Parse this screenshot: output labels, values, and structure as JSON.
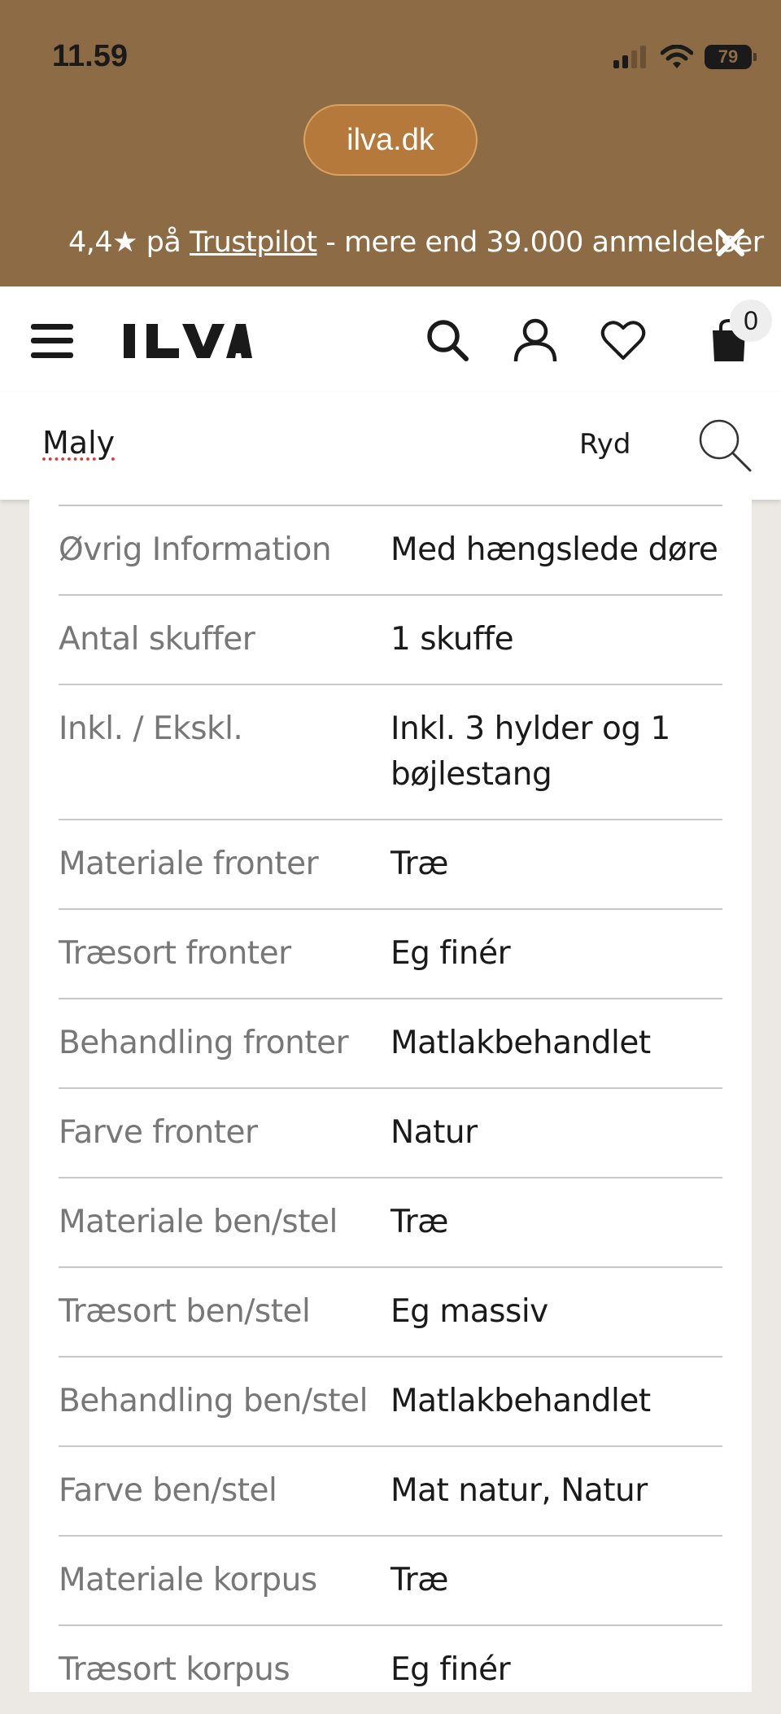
{
  "status_bar": {
    "time": "11.59",
    "battery": "79"
  },
  "browser": {
    "url": "ilva.dk"
  },
  "banner": {
    "rating": "4,4★ på",
    "link": "Trustpilot",
    "suffix": "- mere end 39.000 anmeldelser"
  },
  "header": {
    "logo": "ILVA",
    "cart_count": "0"
  },
  "search": {
    "value": "Maly",
    "clear_label": "Ryd"
  },
  "specs": [
    {
      "label": "Øvrig Information",
      "value": "Med hængslede døre"
    },
    {
      "label": "Antal skuffer",
      "value": "1 skuffe"
    },
    {
      "label": "Inkl. / Ekskl.",
      "value": "Inkl. 3 hylder og 1 bøjlestang"
    },
    {
      "label": "Materiale fronter",
      "value": "Træ"
    },
    {
      "label": "Træsort fronter",
      "value": "Eg finér"
    },
    {
      "label": "Behandling fronter",
      "value": "Matlakbehandlet"
    },
    {
      "label": "Farve fronter",
      "value": "Natur"
    },
    {
      "label": "Materiale ben/stel",
      "value": "Træ"
    },
    {
      "label": "Træsort ben/stel",
      "value": "Eg massiv"
    },
    {
      "label": "Behandling ben/stel",
      "value": "Matlakbehandlet"
    },
    {
      "label": "Farve ben/stel",
      "value": "Mat natur, Natur"
    },
    {
      "label": "Materiale korpus",
      "value": "Træ"
    },
    {
      "label": "Træsort korpus",
      "value": "Eg finér"
    }
  ],
  "colors": {
    "brand_bar": "#8C6B45",
    "url_pill": "#B57A3B"
  },
  "icons": [
    "hamburger-icon",
    "search-icon",
    "account-icon",
    "heart-icon",
    "bag-icon",
    "close-icon",
    "signal-icon",
    "wifi-icon",
    "battery-icon"
  ]
}
